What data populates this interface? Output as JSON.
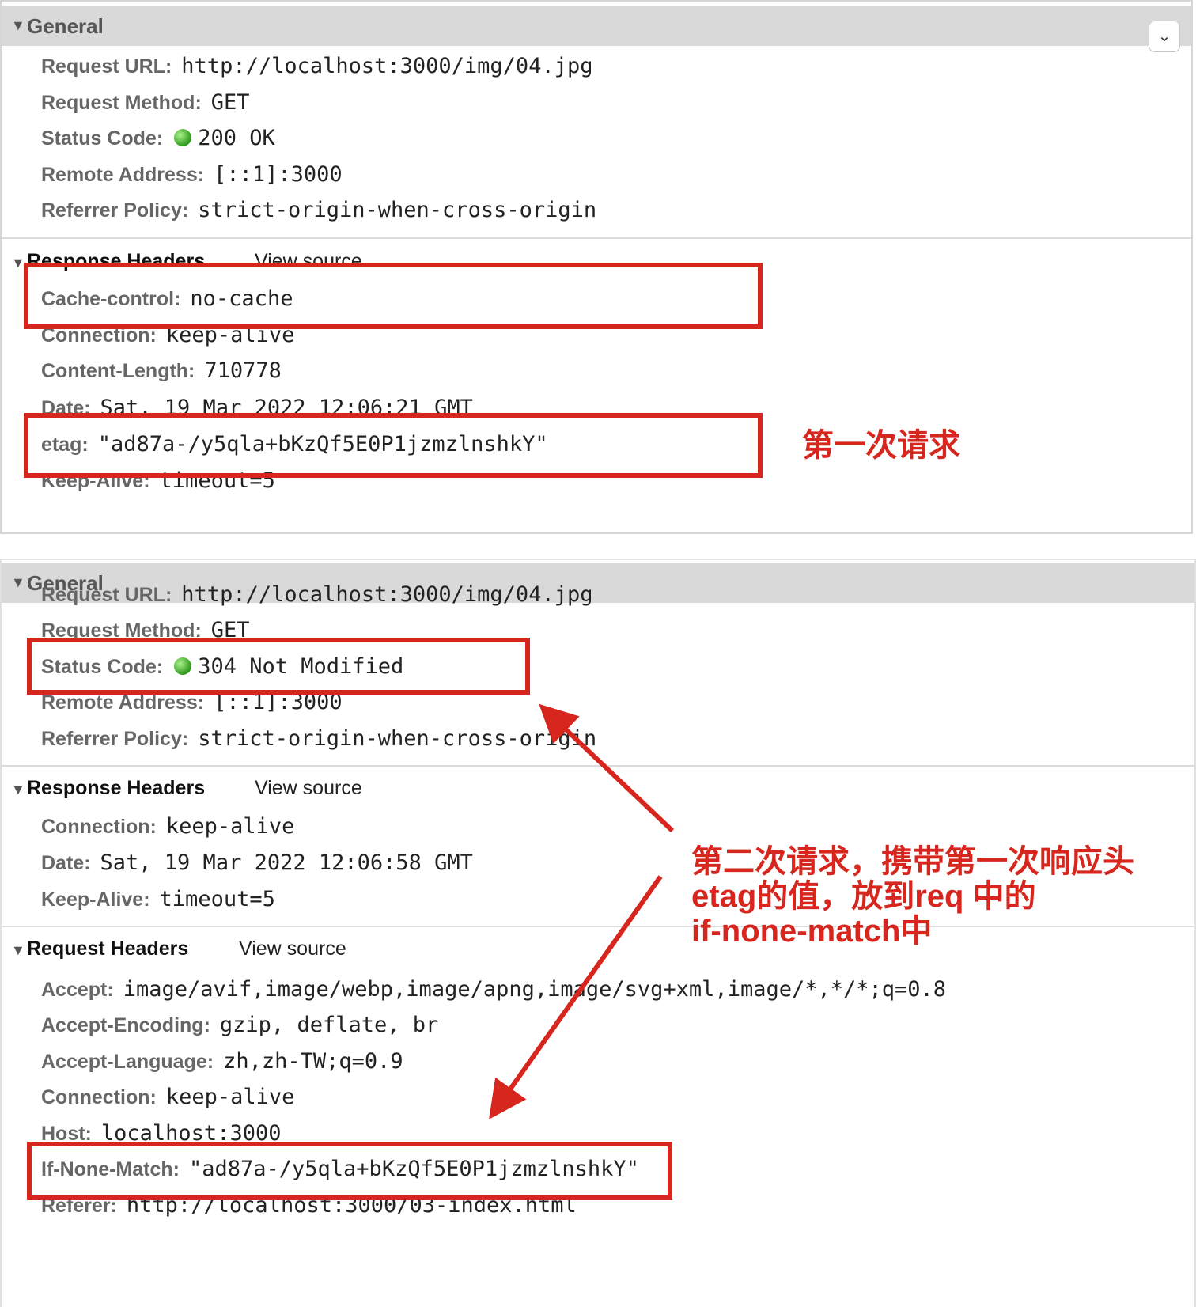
{
  "panel1": {
    "general": {
      "title": "General",
      "collapse_icon": "chevron-down-icon",
      "rows": [
        {
          "key": "Request URL:",
          "value": "http://localhost:3000/img/04.jpg"
        },
        {
          "key": "Request Method:",
          "value": "GET"
        },
        {
          "key": "Status Code:",
          "value": "200 OK"
        },
        {
          "key": "Remote Address:",
          "value": "[::1]:3000"
        },
        {
          "key": "Referrer Policy:",
          "value": "strict-origin-when-cross-origin"
        }
      ]
    },
    "response_headers": {
      "title": "Response Headers",
      "view_source": "View source",
      "rows": [
        {
          "key": "Cache-control:",
          "value": "no-cache"
        },
        {
          "key": "Connection:",
          "value": "keep-alive"
        },
        {
          "key": "Content-Length:",
          "value": "710778"
        },
        {
          "key": "Date:",
          "value": "Sat, 19 Mar 2022 12:06:21 GMT"
        },
        {
          "key": "etag:",
          "value": "\"ad87a-/y5qla+bKzQf5E0P1jzmzlnshkY\""
        },
        {
          "key": "Keep-Alive:",
          "value": "timeout=5"
        }
      ]
    }
  },
  "panel2": {
    "general": {
      "title": "General",
      "rows": [
        {
          "key": "Request URL:",
          "value": "http://localhost:3000/img/04.jpg"
        },
        {
          "key": "Request Method:",
          "value": "GET"
        },
        {
          "key": "Status Code:",
          "value": "304 Not Modified"
        },
        {
          "key": "Remote Address:",
          "value": "[::1]:3000"
        },
        {
          "key": "Referrer Policy:",
          "value": "strict-origin-when-cross-origin"
        }
      ]
    },
    "response_headers": {
      "title": "Response Headers",
      "view_source": "View source",
      "rows": [
        {
          "key": "Connection:",
          "value": "keep-alive"
        },
        {
          "key": "Date:",
          "value": "Sat, 19 Mar 2022 12:06:58 GMT"
        },
        {
          "key": "Keep-Alive:",
          "value": "timeout=5"
        }
      ]
    },
    "request_headers": {
      "title": "Request Headers",
      "view_source": "View source",
      "rows": [
        {
          "key": "Accept:",
          "value": "image/avif,image/webp,image/apng,image/svg+xml,image/*,*/*;q=0.8"
        },
        {
          "key": "Accept-Encoding:",
          "value": "gzip, deflate, br"
        },
        {
          "key": "Accept-Language:",
          "value": "zh,zh-TW;q=0.9"
        },
        {
          "key": "Connection:",
          "value": "keep-alive"
        },
        {
          "key": "Host:",
          "value": "localhost:3000"
        },
        {
          "key": "If-None-Match:",
          "value": "\"ad87a-/y5qla+bKzQf5E0P1jzmzlnshkY\""
        },
        {
          "key": "Referer:",
          "value": "http://localhost:3000/03-index.html"
        }
      ]
    }
  },
  "annotations": {
    "first_request": "第一次请求",
    "second_request": [
      "第二次请求，携带第一次响应头",
      "etag的值，放到req 中的",
      "if-none-match中"
    ],
    "color": "#d7261e"
  },
  "colors": {
    "status_ok": "#3aa522",
    "section_bg": "#d9d9d9",
    "annotation": "#d7261e"
  }
}
